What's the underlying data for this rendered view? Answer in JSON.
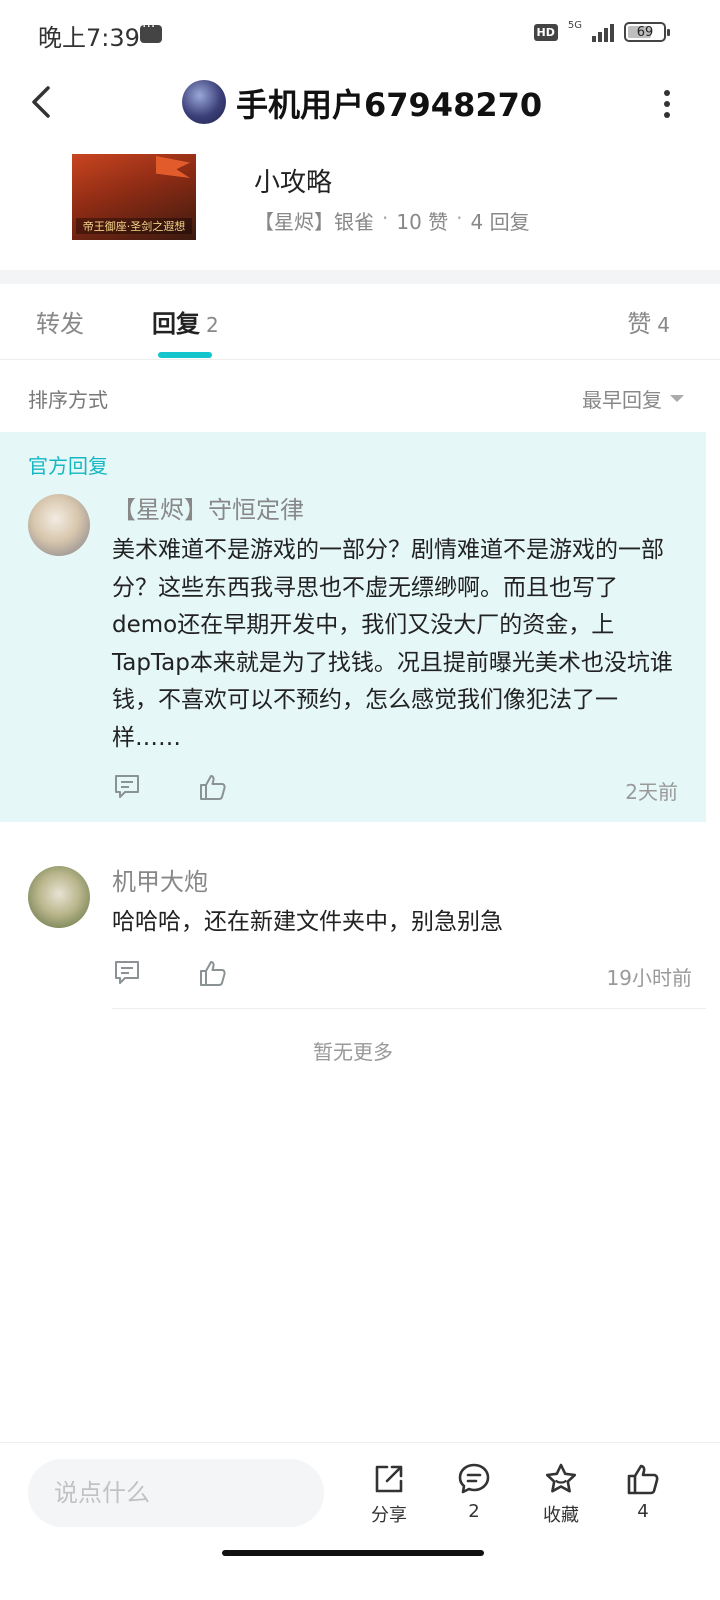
{
  "status_bar": {
    "time": "晚上7:39",
    "hd": "HD",
    "network": "5G",
    "battery": "69",
    "battery_level": 0.69
  },
  "header": {
    "title": "手机用户67948270"
  },
  "post": {
    "title": "小攻略",
    "cover_caption": "帝王御座·圣剑之遐想",
    "author": "【星烬】银雀",
    "likes": "10 赞",
    "replies": "4 回复",
    "separator": "·"
  },
  "tabs": {
    "forward": "转发",
    "reply": "回复",
    "reply_count": "2",
    "like": "赞",
    "like_count": "4"
  },
  "sort": {
    "label": "排序方式",
    "value": "最早回复"
  },
  "replies": [
    {
      "tag": "官方回复",
      "author": "【星烬】守恒定律",
      "content": "美术难道不是游戏的一部分？剧情难道不是游戏的一部分？这些东西我寻思也不虚无缥缈啊。而且也写了demo还在早期开发中，我们又没大厂的资金，上TapTap本来就是为了找钱。况且提前曝光美术也没坑谁钱，不喜欢可以不预约，怎么感觉我们像犯法了一样……",
      "time": "2天前"
    },
    {
      "author": "机甲大炮",
      "content": "哈哈哈，还在新建文件夹中，别急别急",
      "time": "19小时前"
    }
  ],
  "no_more": "暂无更多",
  "bottom_bar": {
    "input_placeholder": "说点什么",
    "share_label": "分享",
    "comment_count": "2",
    "favorite_label": "收藏",
    "like_count": "4"
  },
  "colors": {
    "accent": "#15c5ce",
    "official_bg": "#e6f7f8"
  },
  "icons": [
    "back-icon",
    "more-icon",
    "comment-icon",
    "thumb-up-icon",
    "share-icon",
    "star-icon"
  ]
}
